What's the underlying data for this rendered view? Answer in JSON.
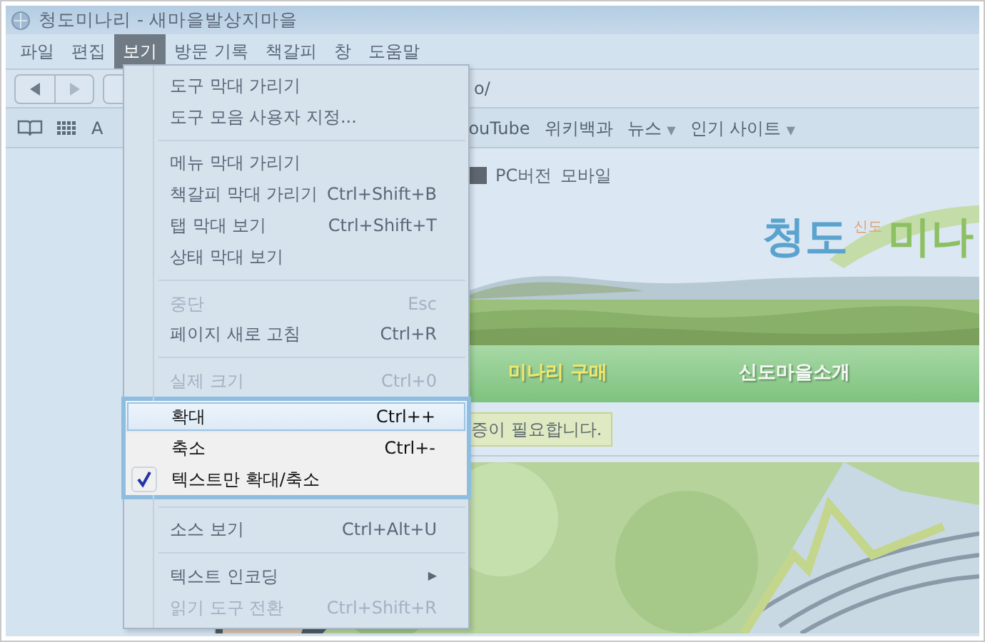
{
  "window": {
    "title": "청도미나리 - 새마을발상지마을"
  },
  "menu_bar": [
    {
      "label": "파일",
      "selected": false
    },
    {
      "label": "편집",
      "selected": false
    },
    {
      "label": "보기",
      "selected": true
    },
    {
      "label": "방문 기록",
      "selected": false
    },
    {
      "label": "책갈피",
      "selected": false
    },
    {
      "label": "창",
      "selected": false
    },
    {
      "label": "도움말",
      "selected": false
    }
  ],
  "address_bar": {
    "value": "o/"
  },
  "bookmarks": [
    {
      "label": "A"
    },
    {
      "label": "ouTube"
    },
    {
      "label": "위키백과"
    },
    {
      "label": "뉴스",
      "caret": "▼"
    },
    {
      "label": "인기 사이트",
      "caret": "▼"
    }
  ],
  "view_menu": {
    "items": [
      {
        "kind": "item",
        "label": "도구 막대 가리기",
        "disabled": false,
        "checked": false,
        "selected": false,
        "emphasized": false
      },
      {
        "kind": "item",
        "label": "도구 모음 사용자 지정...",
        "disabled": false,
        "checked": false,
        "selected": false,
        "emphasized": false
      },
      {
        "kind": "separator"
      },
      {
        "kind": "item",
        "label": "메뉴 막대 가리기",
        "disabled": false,
        "checked": false,
        "selected": false,
        "emphasized": false
      },
      {
        "kind": "item",
        "label": "책갈피 막대 가리기",
        "shortcut": "Ctrl+Shift+B",
        "disabled": false,
        "checked": false,
        "selected": false,
        "emphasized": false
      },
      {
        "kind": "item",
        "label": "탭 막대 보기",
        "shortcut": "Ctrl+Shift+T",
        "disabled": false,
        "checked": false,
        "selected": false,
        "emphasized": false
      },
      {
        "kind": "item",
        "label": "상태 막대 보기",
        "disabled": false,
        "checked": false,
        "selected": false,
        "emphasized": false
      },
      {
        "kind": "separator"
      },
      {
        "kind": "item",
        "label": "중단",
        "shortcut": "Esc",
        "disabled": true,
        "checked": false,
        "selected": false,
        "emphasized": false
      },
      {
        "kind": "item",
        "label": "페이지 새로 고침",
        "shortcut": "Ctrl+R",
        "disabled": false,
        "checked": false,
        "selected": false,
        "emphasized": false
      },
      {
        "kind": "separator"
      },
      {
        "kind": "item",
        "label": "실제 크기",
        "shortcut": "Ctrl+0",
        "disabled": true,
        "checked": false,
        "selected": false,
        "emphasized": false
      },
      {
        "kind": "item",
        "label": "확대",
        "shortcut": "Ctrl++",
        "disabled": false,
        "checked": false,
        "selected": true,
        "emphasized": true
      },
      {
        "kind": "item",
        "label": "축소",
        "shortcut": "Ctrl+-",
        "disabled": false,
        "checked": false,
        "selected": false,
        "emphasized": true
      },
      {
        "kind": "item",
        "label": "텍스트만 확대/축소",
        "disabled": false,
        "checked": true,
        "selected": false,
        "emphasized": true
      },
      {
        "kind": "separator"
      },
      {
        "kind": "item",
        "label": "소스 보기",
        "shortcut": "Ctrl+Alt+U",
        "disabled": false,
        "checked": false,
        "selected": false,
        "emphasized": false
      },
      {
        "kind": "separator"
      },
      {
        "kind": "submenu",
        "label": "텍스트 인코딩",
        "arrow": "▶",
        "disabled": false,
        "checked": false,
        "selected": false,
        "emphasized": false
      },
      {
        "kind": "item",
        "label": "읽기 도구 전환",
        "shortcut": "Ctrl+Shift+R",
        "disabled": true,
        "checked": false,
        "selected": false,
        "emphasized": false
      }
    ]
  },
  "page": {
    "links": [
      "PC버전",
      "모바일"
    ],
    "logo": {
      "title": "청도",
      "sub": "신도",
      "tail": "미나"
    },
    "nav": [
      {
        "label": "미나리 구매",
        "selected": true
      },
      {
        "label": "신도마을소개",
        "selected": false
      }
    ],
    "notice": "증이 필요합니다."
  }
}
